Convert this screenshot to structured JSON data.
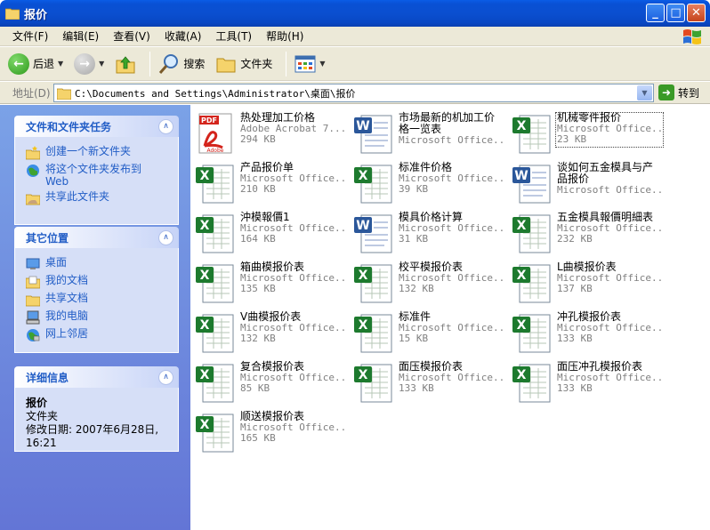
{
  "window": {
    "title": "报价",
    "buttons": {
      "minimize": "_",
      "maximize": "□",
      "close": "✕"
    }
  },
  "menu": [
    "文件(F)",
    "编辑(E)",
    "查看(V)",
    "收藏(A)",
    "工具(T)",
    "帮助(H)"
  ],
  "toolbar": {
    "back": "后退",
    "search": "搜索",
    "folders": "文件夹"
  },
  "address": {
    "label": "地址(D)",
    "path": "C:\\Documents and Settings\\Administrator\\桌面\\报价",
    "go": "转到"
  },
  "tasks_panel": {
    "title": "文件和文件夹任务",
    "items": [
      {
        "label": "创建一个新文件夹",
        "icon": "new-folder-icon"
      },
      {
        "label": "将这个文件夹发布到\nWeb",
        "icon": "publish-web-icon"
      },
      {
        "label": "共享此文件夹",
        "icon": "share-folder-icon"
      }
    ]
  },
  "places_panel": {
    "title": "其它位置",
    "items": [
      {
        "label": "桌面",
        "icon": "desktop-icon"
      },
      {
        "label": "我的文档",
        "icon": "my-documents-icon"
      },
      {
        "label": "共享文档",
        "icon": "shared-documents-icon"
      },
      {
        "label": "我的电脑",
        "icon": "my-computer-icon"
      },
      {
        "label": "网上邻居",
        "icon": "network-places-icon"
      }
    ]
  },
  "details_panel": {
    "title": "详细信息",
    "name": "报价",
    "type": "文件夹",
    "modified": "修改日期: 2007年6月28日, 16:21"
  },
  "files": [
    {
      "name": "热处理加工价格",
      "type": "Adobe Acrobat 7....",
      "size": "294 KB",
      "kind": "pdf"
    },
    {
      "name": "市场最新的机加工价格一览表",
      "type": "Microsoft Office...",
      "size": "",
      "kind": "word"
    },
    {
      "name": "机械零件报价",
      "type": "Microsoft Office...",
      "size": "23 KB",
      "kind": "excel"
    },
    {
      "name": "产品报价单",
      "type": "Microsoft Office...",
      "size": "210 KB",
      "kind": "excel"
    },
    {
      "name": "标准件价格",
      "type": "Microsoft Office...",
      "size": "39 KB",
      "kind": "excel"
    },
    {
      "name": "谈如何五金模具与产品报价",
      "type": "Microsoft Office...",
      "size": "",
      "kind": "word"
    },
    {
      "name": "沖模報價1",
      "type": "Microsoft Office...",
      "size": "164 KB",
      "kind": "excel"
    },
    {
      "name": "模具价格计算",
      "type": "Microsoft Office...",
      "size": "31 KB",
      "kind": "word"
    },
    {
      "name": "五金模具報價明細表",
      "type": "Microsoft Office...",
      "size": "232 KB",
      "kind": "excel"
    },
    {
      "name": "箱曲模报价表",
      "type": "Microsoft Office...",
      "size": "135 KB",
      "kind": "excel"
    },
    {
      "name": "校平模报价表",
      "type": "Microsoft Office...",
      "size": "132 KB",
      "kind": "excel"
    },
    {
      "name": "L曲模报价表",
      "type": "Microsoft Office...",
      "size": "137 KB",
      "kind": "excel"
    },
    {
      "name": "V曲模报价表",
      "type": "Microsoft Office...",
      "size": "132 KB",
      "kind": "excel"
    },
    {
      "name": "标准件",
      "type": "Microsoft Office...",
      "size": "15 KB",
      "kind": "excel"
    },
    {
      "name": "冲孔模报价表",
      "type": "Microsoft Office...",
      "size": "133 KB",
      "kind": "excel"
    },
    {
      "name": "复合模报价表",
      "type": "Microsoft Office...",
      "size": "85 KB",
      "kind": "excel"
    },
    {
      "name": "面压模报价表",
      "type": "Microsoft Office...",
      "size": "133 KB",
      "kind": "excel"
    },
    {
      "name": "面压冲孔模报价表",
      "type": "Microsoft Office...",
      "size": "133 KB",
      "kind": "excel"
    },
    {
      "name": "顺送模报价表",
      "type": "Microsoft Office...",
      "size": "165 KB",
      "kind": "excel"
    }
  ],
  "colors": {
    "titlebar": "#0a4fd0",
    "taskpane": "#6f8fdf",
    "link": "#215dc6",
    "excel": "#1d7a2e",
    "word": "#2b579a",
    "pdf": "#d4241c"
  }
}
